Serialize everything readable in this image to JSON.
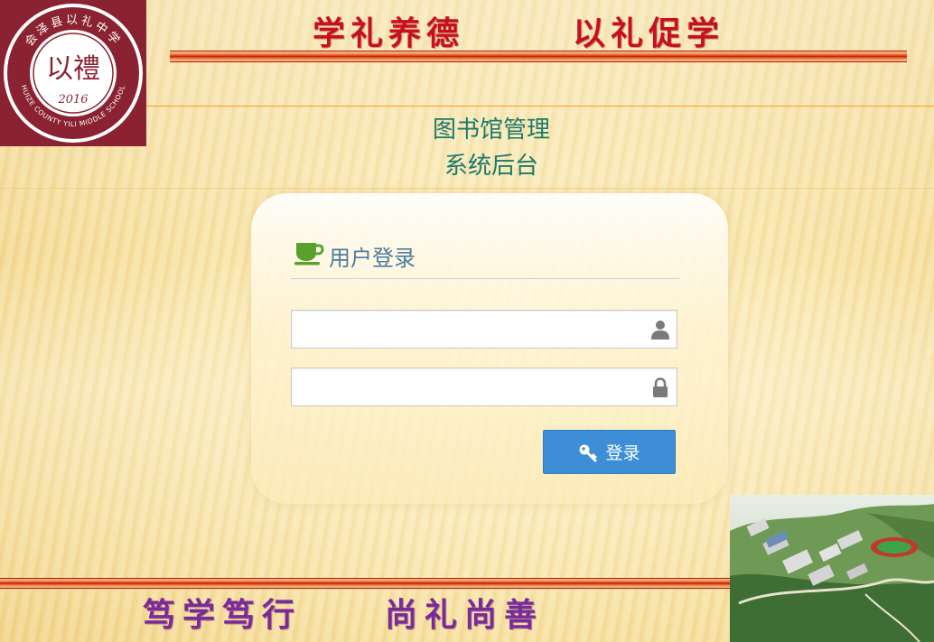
{
  "header": {
    "logo": {
      "ring_text": "会泽县以礼中学",
      "ring_text_en": "HUIZE COUNTY YILI MIDDLE SCHOOL",
      "mark": "以禮",
      "year": "2016",
      "color": "#8b2231"
    },
    "slogan_left": "学礼养德",
    "slogan_right": "以礼促学"
  },
  "system_title": {
    "line1": "图书馆管理",
    "line2": "系统后台"
  },
  "login": {
    "header_icon": "coffee-cup-icon",
    "title": "用户登录",
    "username": {
      "value": "",
      "placeholder": "",
      "icon": "user-icon"
    },
    "password": {
      "value": "",
      "placeholder": "",
      "icon": "lock-icon"
    },
    "submit": {
      "label": "登录",
      "icon": "key-icon",
      "color": "#3d8ed6"
    }
  },
  "footer": {
    "slogan_left": "笃学笃行",
    "slogan_right": "尚礼尚善",
    "photo": "campus-aerial-photo"
  },
  "colors": {
    "accent_red": "#c8101c",
    "slogan_purple": "#7a2a9a",
    "title_teal": "#1a7a6a",
    "card_title_blue": "#4d7ba0"
  }
}
